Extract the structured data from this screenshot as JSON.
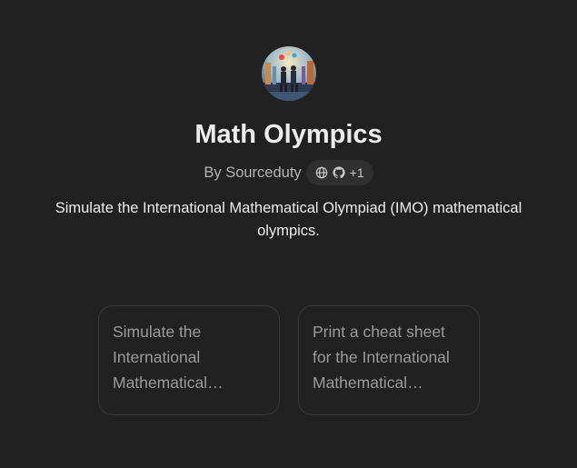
{
  "gpt": {
    "name": "Math Olympics",
    "author": "By Sourceduty",
    "extra_count": "+1",
    "description": "Simulate the International Mathematical Olympiad (IMO) mathematical olympics.",
    "icons": [
      "globe-icon",
      "github-icon"
    ]
  },
  "conversation_starters": [
    {
      "text": "Simulate the International Mathematical Olympiad (IMO) mathematical olympics."
    },
    {
      "text": "Print a cheat sheet for the International Mathematical Olympiad."
    }
  ],
  "colors": {
    "background": "#212121",
    "title": "#ececec",
    "muted": "#b4b4b4",
    "pill_bg": "#2f2f2f",
    "card_border": "#3a3a3a",
    "card_text": "#9b9b9b"
  }
}
